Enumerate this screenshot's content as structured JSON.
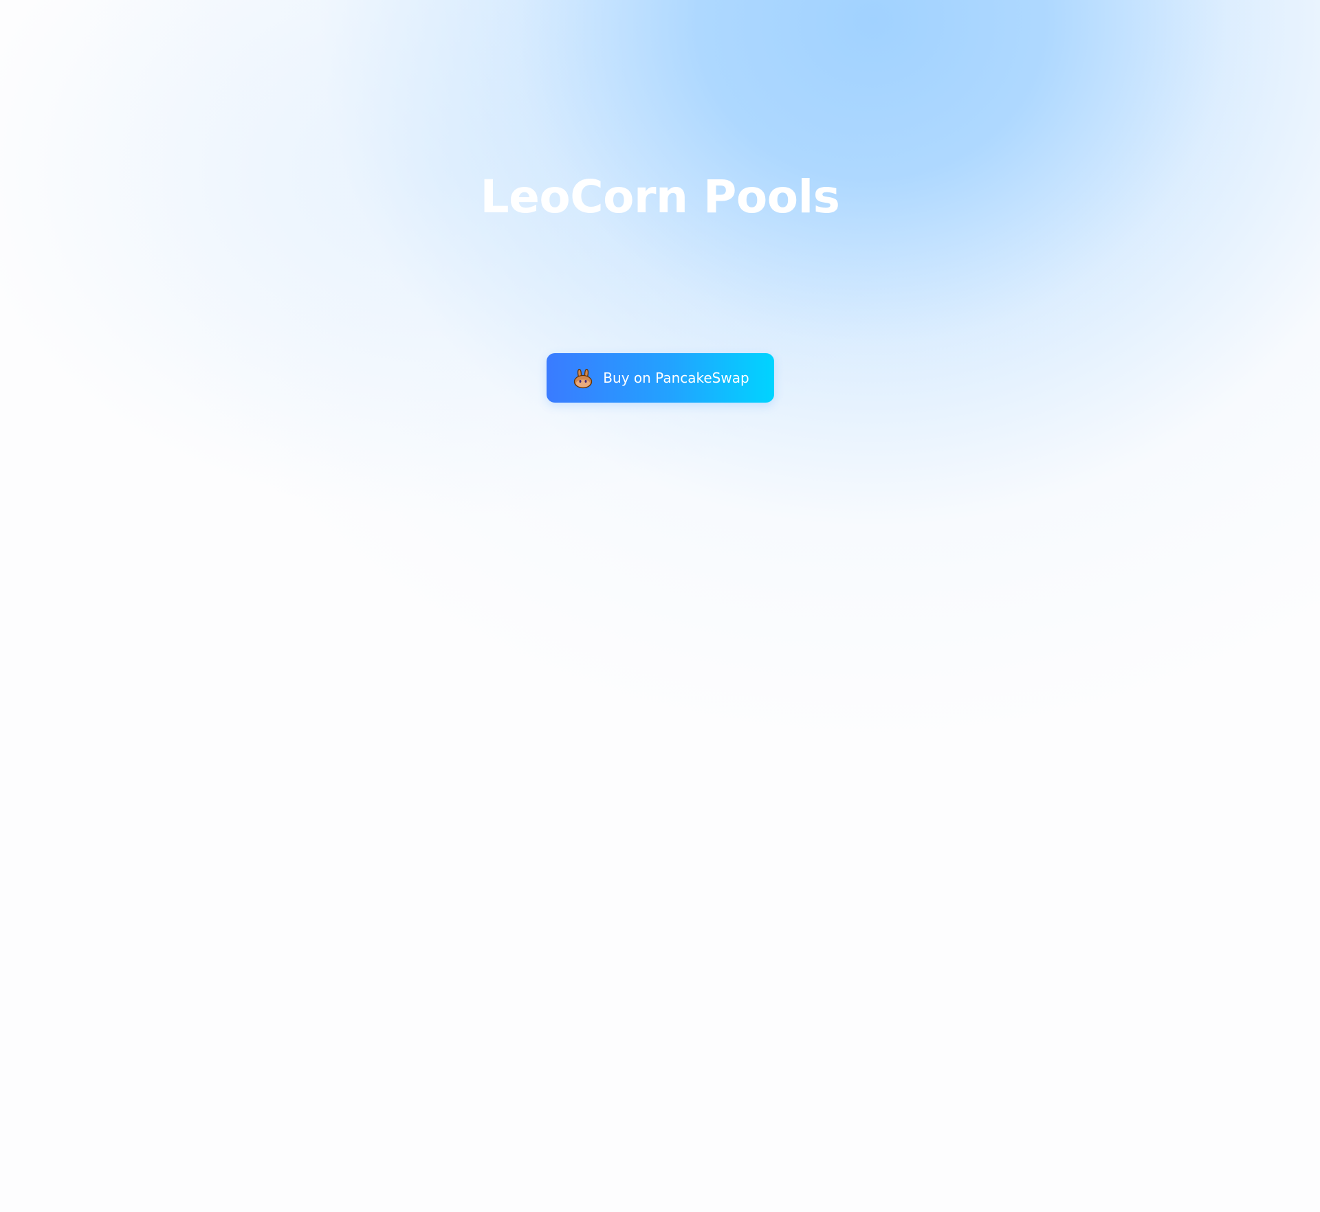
{
  "hero": {
    "title": "LeoCorn Pools",
    "cta": {
      "label": "Buy on PancakeSwap",
      "icon": "pancakeswap-bunny-icon"
    }
  },
  "colors": {
    "title_text": "#ffffff",
    "button_gradient_start": "#3a7bff",
    "button_gradient_end": "#00d4ff",
    "background_glow": "#a1d2ff",
    "background_base": "#fdfdfe"
  }
}
